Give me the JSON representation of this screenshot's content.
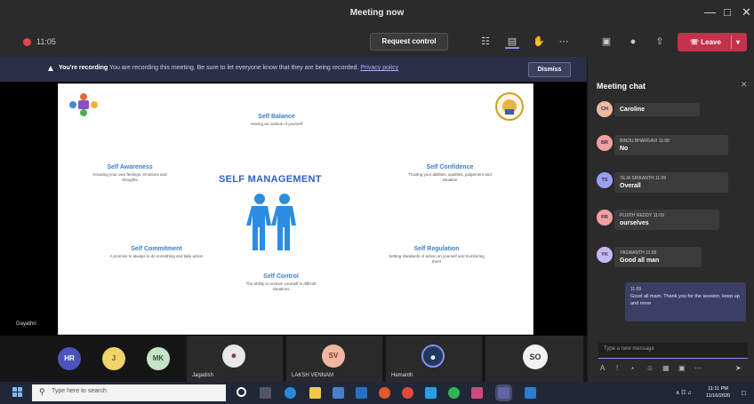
{
  "window": {
    "title": "Meeting now"
  },
  "toolbar": {
    "timer": "11:05",
    "request_control": "Request control",
    "leave": "Leave"
  },
  "banner": {
    "bold": "You're recording",
    "text": "You are recording this meeting. Be sure to let everyone know that they are being recorded.",
    "link": "Privacy policy",
    "dismiss": "Dismiss"
  },
  "slide": {
    "title": "SELF MANAGEMENT",
    "items": [
      {
        "heading": "Self Balance",
        "desc": "Having an outlook of yourself"
      },
      {
        "heading": "Self Awareness",
        "desc": "Knowing your own feelings, emotions and thoughts"
      },
      {
        "heading": "Self Confidence",
        "desc": "Trusting your abilities, qualities, judgement and situation"
      },
      {
        "heading": "Self Commitment",
        "desc": "A promise to always to do something and take action"
      },
      {
        "heading": "Self Regulation",
        "desc": "Setting standards of action on yourself and monitoring them"
      },
      {
        "heading": "Self Control",
        "desc": "The ability to restrain yourself in difficult situations"
      }
    ]
  },
  "stage": {
    "presenter": "Gayathri"
  },
  "participants": [
    {
      "initials": "HR",
      "name": "",
      "color": "#4b53bc"
    },
    {
      "initials": "J",
      "name": "",
      "color": "#f1d36b"
    },
    {
      "initials": "MK",
      "name": "",
      "color": "#c7e3c7"
    },
    {
      "initials": "",
      "name": "Jagadish",
      "color": "#ffffff"
    },
    {
      "initials": "SV",
      "name": "LAKSH VENNAM",
      "color": "#f0b8a0"
    },
    {
      "initials": "",
      "name": "Hemanth",
      "color": "#8b8cf0"
    },
    {
      "initials": "SO",
      "name": "",
      "color": "#f2f2f2"
    }
  ],
  "chat": {
    "title": "Meeting chat",
    "messages": [
      {
        "initials": "CH",
        "author": "",
        "time": "",
        "text": "Caroline",
        "color": "#f0b8a0"
      },
      {
        "initials": "BR",
        "author": "BINDU BHARGAVI",
        "time": "11:08",
        "text": "No",
        "color": "#f2a0a0"
      },
      {
        "initials": "TS",
        "author": "TEJA SRIKANTH",
        "time": "11:09",
        "text": "Overall",
        "color": "#9aa0f0"
      },
      {
        "initials": "PR",
        "author": "PUJITH REDDY",
        "time": "11:09",
        "text": "ourselves",
        "color": "#f2a0a0"
      },
      {
        "initials": "YK",
        "author": "YASWANTH",
        "time": "11:09",
        "text": "Good all man",
        "color": "#c8b8f0"
      }
    ],
    "own_message": {
      "time": "11:09",
      "text": "Good all mam. Thank you for the session, keep up and more"
    },
    "compose_placeholder": "Type a new message"
  },
  "taskbar": {
    "search_placeholder": "Type here to search",
    "time": "11:11 PM",
    "date": "11/16/2020"
  }
}
